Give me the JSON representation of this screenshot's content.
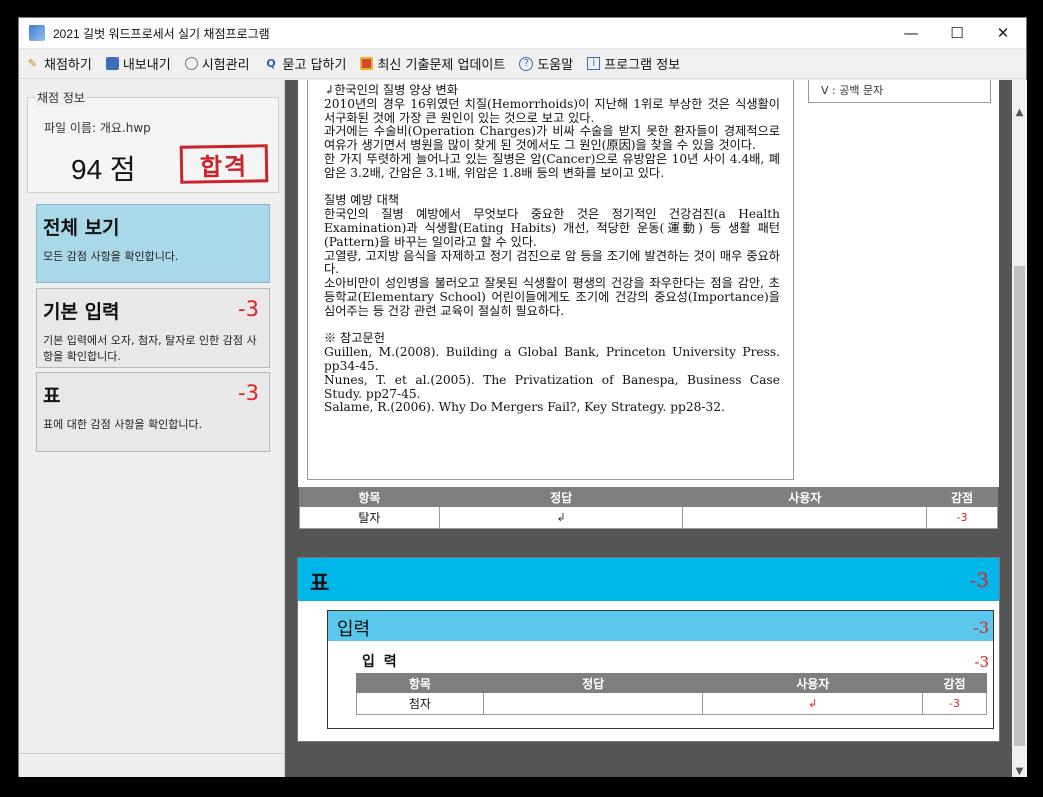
{
  "window": {
    "title": "2021 길벗 워드프로세서 실기 채점프로그램"
  },
  "menu": [
    {
      "label": "채점하기",
      "icon": "pencil-icon"
    },
    {
      "label": "내보내기",
      "icon": "save-icon"
    },
    {
      "label": "시험관리",
      "icon": "timer-icon"
    },
    {
      "label": "묻고 답하기",
      "icon": "qa-icon"
    },
    {
      "label": "최신 기출문제 업데이트",
      "icon": "gift-icon"
    },
    {
      "label": "도움말",
      "icon": "help-icon"
    },
    {
      "label": "프로그램 정보",
      "icon": "info-icon"
    }
  ],
  "score_info": {
    "label": "채점 정보",
    "file_name": "파일 이름: 개요.hwp",
    "score": "94 점",
    "result": "합격"
  },
  "categories": [
    {
      "title": "전체 보기",
      "deduction": "",
      "desc": "모든 감점 사항을 확인합니다."
    },
    {
      "title": "기본 입력",
      "deduction": "-3",
      "desc": "기본 입력에서 오자, 첨자, 탈자로 인한 감점 사항을 확인합니다."
    },
    {
      "title": "표",
      "deduction": "-3",
      "desc": "표에 대한 감점 사항을 확인합니다."
    }
  ],
  "document": {
    "text": "↲한국인의 질병 양상 변화\n2010년의 경우 16위였던 치질(Hemorrhoids)이 지난해 1위로 부상한 것은 식생활이 서구화된 것에 가장 큰 원인이 있는 것으로 보고 있다.\n과거에는 수술비(Operation Charges)가 비싸 수술을 받지 못한 환자들이 경제적으로 여유가 생기면서 병원을 많이 찾게 된 것에서도 그 원인(原因)을 찾을 수 있을 것이다.\n한 가지 뚜렷하게 늘어나고 있는 질병은 암(Cancer)으로 유방암은 10년 사이 4.4배, 폐암은 3.2배, 간암은 3.1배, 위암은 1.8배 등의 변화를 보이고 있다.\n\n질병 예방 대책\n한국인의 질병 예방에서 무엇보다 중요한 것은 정기적인 건강검진(a Health Examination)과 식생활(Eating Habits) 개선, 적당한 운동(運動) 등 생활 패턴(Pattern)을 바꾸는 일이라고 할 수 있다.\n고열량, 고지방 음식을 자제하고 정기 검진으로 암 등을 조기에 발견하는 것이 매우 중요하다.\n소아비만이 성인병을 불러오고 잘못된 식생활이 평생의 건강을 좌우한다는 점을 감안, 초등학교(Elementary School) 어린이들에게도 조기에 건강의 중요성(Importance)을 심어주는 등 건강 관련 교육이 절실히 필요하다.\n\n※ 참고문헌\nGuillen, M.(2008). Building a Global Bank, Princeton University Press. pp34-45.\nNunes, T. et al.(2005). The Privatization of Banespa, Business Case Study. pp27-45.\nSalame, R.(2006). Why Do Mergers Fail?, Key Strategy. pp28-32.",
    "side_note": "V : 공백 문자"
  },
  "table_headers": {
    "item": "항목",
    "answer": "정답",
    "user": "사용자",
    "deduction": "감점"
  },
  "basic_input_row": {
    "item": "탈자",
    "answer": "↲",
    "user": "",
    "deduction": "-3"
  },
  "table_section": {
    "title": "표",
    "deduction": "-3",
    "sub_title": "입력",
    "sub_deduction": "-3",
    "item_title": "입 력",
    "item_deduction": "-3",
    "row": {
      "item": "첨자",
      "answer": "",
      "user": "↲",
      "deduction": "-3"
    }
  },
  "window_controls": {
    "minimize": "—",
    "maximize": "☐",
    "close": "✕"
  },
  "scroll": {
    "up": "▲",
    "down": "▼"
  }
}
